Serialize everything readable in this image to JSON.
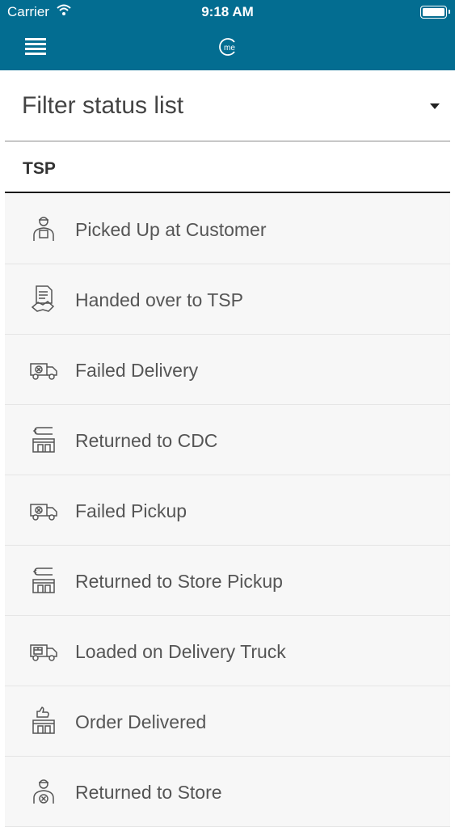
{
  "status_bar": {
    "carrier": "Carrier",
    "time": "9:18 AM"
  },
  "nav": {
    "logo_text": "me",
    "menu_icon": "hamburger-menu-icon"
  },
  "filter": {
    "label": "Filter status list"
  },
  "section": {
    "title": "TSP"
  },
  "items": [
    {
      "label": "Picked Up at Customer",
      "icon": "courier-with-box-icon"
    },
    {
      "label": "Handed over to TSP",
      "icon": "document-handshake-icon"
    },
    {
      "label": "Failed Delivery",
      "icon": "truck-failed-icon"
    },
    {
      "label": "Returned to CDC",
      "icon": "store-return-icon"
    },
    {
      "label": "Failed Pickup",
      "icon": "truck-failed-icon"
    },
    {
      "label": "Returned to Store Pickup",
      "icon": "store-return-icon"
    },
    {
      "label": "Loaded on Delivery Truck",
      "icon": "truck-loaded-icon"
    },
    {
      "label": "Order Delivered",
      "icon": "store-thumbs-up-icon"
    },
    {
      "label": "Returned to Store",
      "icon": "courier-failed-icon"
    }
  ]
}
